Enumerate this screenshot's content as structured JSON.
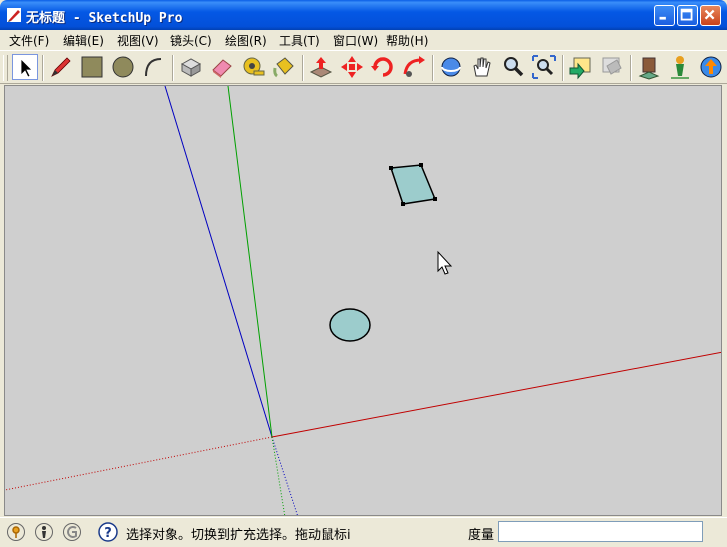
{
  "window": {
    "title": "无标题 - SketchUp Pro"
  },
  "menu": [
    {
      "label": "文件(F)"
    },
    {
      "label": "编辑(E)"
    },
    {
      "label": "视图(V)"
    },
    {
      "label": "镜头(C)"
    },
    {
      "label": "绘图(R)"
    },
    {
      "label": "工具(T)"
    },
    {
      "label": "窗口(W)"
    },
    {
      "label": "帮助(H)"
    }
  ],
  "toolbar_icons": [
    "select-icon",
    "pencil-icon",
    "rectangle-icon",
    "circle-icon",
    "arc-icon",
    "make-component-icon",
    "eraser-icon",
    "tape-measure-icon",
    "paint-bucket-icon",
    "push-pull-icon",
    "move-icon",
    "rotate-icon",
    "follow-me-icon",
    "orbit-icon",
    "pan-icon",
    "zoom-icon",
    "zoom-extents-icon",
    "previous-view-icon",
    "next-view-icon",
    "components-icon",
    "add-location-icon",
    "upload-icon"
  ],
  "status": {
    "hint": "选择对象。切换到扩充选择。拖动鼠标i",
    "measure_label": "度量",
    "measure_value": ""
  },
  "colors": {
    "title_bar": "#0458e5",
    "viewport_bg": "#cfcfcf",
    "face_fill": "#9ccccc",
    "axis_red": "#c00000",
    "axis_green": "#00a000",
    "axis_blue": "#0000c0"
  }
}
